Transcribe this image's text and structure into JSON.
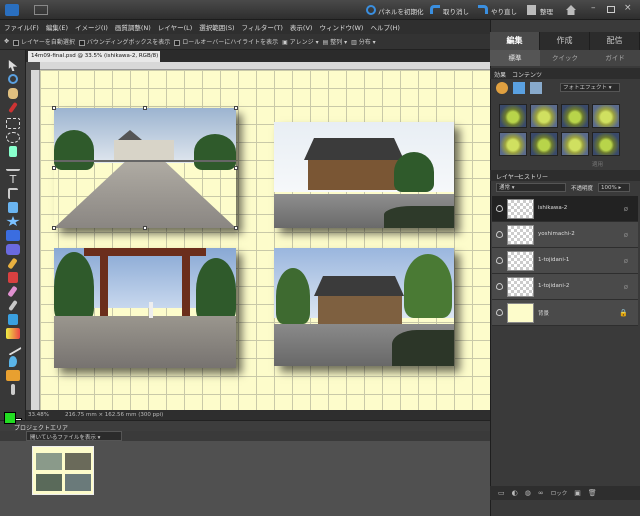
{
  "titlebar": {
    "panel_reset": "パネルを初期化",
    "undo": "取り消し",
    "redo": "やり直し",
    "organize": "整理"
  },
  "menu": [
    "ファイル(F)",
    "編集(E)",
    "イメージ(I)",
    "画質調整(N)",
    "レイヤー(L)",
    "選択範囲(S)",
    "フィルター(T)",
    "表示(V)",
    "ウィンドウ(W)",
    "ヘルプ(H)"
  ],
  "options": {
    "auto_select": "レイヤーを自動選択",
    "show_bbox": "バウンディングボックスを表示",
    "highlight": "ロールオーバーにハイライトを表示",
    "arrange": "アレンジ",
    "align": "整列",
    "distribute": "分布"
  },
  "document": {
    "tab": "14m09-final.psd @ 33.5% (ishikawa-2, RGB/8) ×",
    "zoom": "33.48%",
    "dimensions": "216.75 mm × 162.56 mm (300 ppi)"
  },
  "project_bin": {
    "title": "プロジェクトエリア",
    "filter": "開いているファイルを表示"
  },
  "modes": {
    "edit": "編集",
    "create": "作成",
    "share": "配信"
  },
  "submodes": {
    "full": "標準",
    "quick": "クイック",
    "guided": "ガイド"
  },
  "effects": {
    "tab1": "効果",
    "tab2": "コンテンツ",
    "category": "フォトエフェクト",
    "apply": "適用"
  },
  "layers_panel": {
    "tab1": "レイヤー",
    "tab2": "ヒストリー",
    "blend": "通常",
    "opacity_label": "不透明度",
    "opacity": "100%"
  },
  "layers": [
    {
      "name": "ishikawa-2",
      "active": true,
      "lock": "ø"
    },
    {
      "name": "yoshimachi-2",
      "active": false,
      "lock": "ø"
    },
    {
      "name": "1-tojidani-1",
      "active": false,
      "lock": "ø"
    },
    {
      "name": "1-tojidani-2",
      "active": false,
      "lock": "ø"
    },
    {
      "name": "背景",
      "active": false,
      "lock": "🔒"
    }
  ],
  "layer_footer": {
    "lock": "ロック"
  },
  "colors": {
    "foreground": "#22dd22",
    "background": "#ffffff",
    "canvas": "#fdfccb"
  }
}
